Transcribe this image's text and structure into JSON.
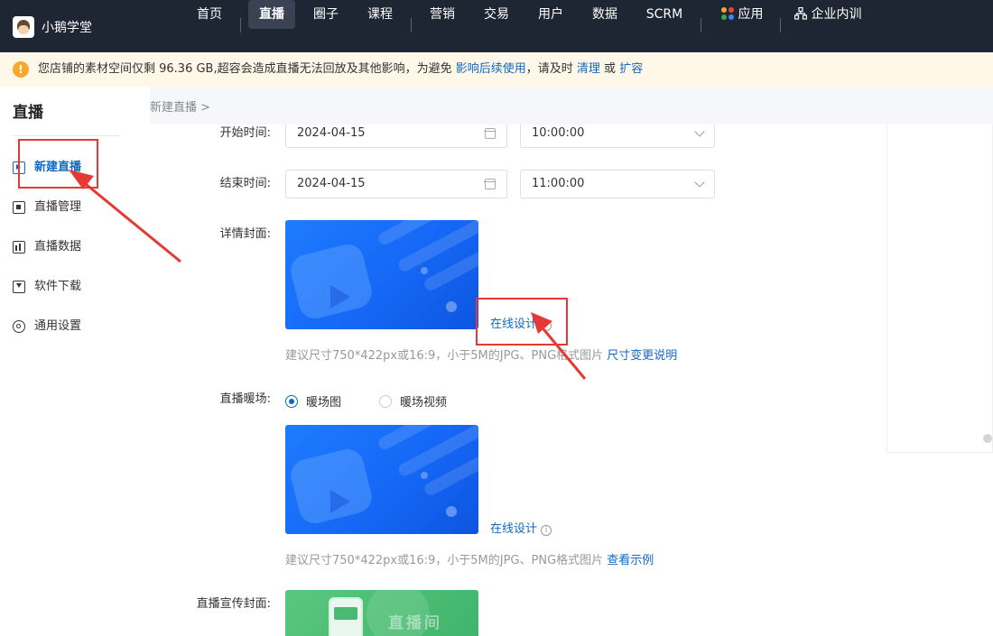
{
  "brand": {
    "name": "小鹅学堂"
  },
  "nav": {
    "items": [
      {
        "label": "首页"
      },
      {
        "label": "直播",
        "active": true
      },
      {
        "label": "圈子"
      },
      {
        "label": "课程"
      },
      {
        "label": "营销"
      },
      {
        "label": "交易"
      },
      {
        "label": "用户"
      },
      {
        "label": "数据"
      },
      {
        "label": "SCRM"
      },
      {
        "label": "应用"
      },
      {
        "label": "企业内训"
      }
    ]
  },
  "notice": {
    "icon": "warning-icon",
    "text_before": "您店铺的素材空间仅剩 96.36 GB,超容会造成直播无法回放及其他影响，为避免 ",
    "link_impact": "影响后续使用",
    "text_middle": "，请及时 ",
    "link_clean": "清理",
    "text_or": " 或 ",
    "link_expand": "扩容"
  },
  "sidebar": {
    "title": "直播",
    "items": [
      {
        "label": "新建直播",
        "icon": "new-live-icon",
        "active": true
      },
      {
        "label": "直播管理",
        "icon": "live-manage-icon"
      },
      {
        "label": "直播数据",
        "icon": "live-data-icon"
      },
      {
        "label": "软件下载",
        "icon": "download-icon"
      },
      {
        "label": "通用设置",
        "icon": "gear-icon"
      }
    ]
  },
  "breadcrumb": {
    "text": "新建直播 >"
  },
  "form": {
    "start": {
      "label": "开始时间:",
      "date": "2024-04-15",
      "time": "10:00:00"
    },
    "end": {
      "label": "结束时间:",
      "date": "2024-04-15",
      "time": "11:00:00"
    },
    "detail_cover": {
      "label": "详情封面:",
      "design_link": "在线设计",
      "hint": "建议尺寸750*422px或16:9，小于5M的JPG、PNG格式图片 ",
      "hint_link": "尺寸变更说明"
    },
    "warmup": {
      "label": "直播暖场:",
      "options": [
        {
          "label": "暖场图",
          "selected": true
        },
        {
          "label": "暖场视频",
          "selected": false
        }
      ],
      "design_link": "在线设计",
      "hint": "建议尺寸750*422px或16:9，小于5M的JPG、PNG格式图片 ",
      "hint_link": "查看示例"
    },
    "promo_cover": {
      "label": "直播宣传封面:",
      "image_text": "直播间"
    }
  },
  "colors": {
    "accent": "#1068c2",
    "topbar": "#1f2633",
    "annotation": "#e53935"
  }
}
